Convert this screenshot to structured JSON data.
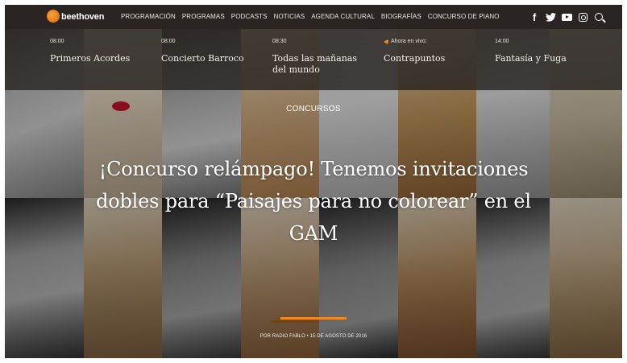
{
  "brand": {
    "name": "beethoven",
    "accent_color": "#f08a1e"
  },
  "nav": {
    "items": [
      {
        "label": "PROGRAMACIÓN"
      },
      {
        "label": "PROGRAMAS"
      },
      {
        "label": "PODCASTS"
      },
      {
        "label": "NOTICIAS"
      },
      {
        "label": "AGENDA CULTURAL"
      },
      {
        "label": "BIOGRAFÍAS"
      },
      {
        "label": "CONCURSO DE PIANO"
      }
    ],
    "social": [
      {
        "icon": "facebook-icon",
        "glyph": "f"
      },
      {
        "icon": "twitter-icon",
        "glyph": "🐦"
      },
      {
        "icon": "youtube-icon",
        "glyph": ""
      },
      {
        "icon": "instagram-icon",
        "glyph": ""
      },
      {
        "icon": "search-icon",
        "glyph": ""
      }
    ]
  },
  "schedule": [
    {
      "time": "08:00",
      "title": "Primeros Acordes",
      "live": false
    },
    {
      "time": "08:00",
      "title": "Concierto Barroco",
      "live": false
    },
    {
      "time": "08:30",
      "title": "Todas las mañanas del mundo",
      "live": false
    },
    {
      "time": "Ahora en vivo:",
      "title": "Contrapuntos",
      "live": true
    },
    {
      "time": "14:00",
      "title": "Fantasía y Fuga",
      "live": false
    }
  ],
  "hero": {
    "category": "CONCURSOS",
    "headline": "¡Concurso relámpago! Tenemos invitaciones dobles para “Paisajes para no colorear” en el GAM",
    "byline": "POR RADIO FABLO • 15 DE AGOSTO DE 2016"
  }
}
